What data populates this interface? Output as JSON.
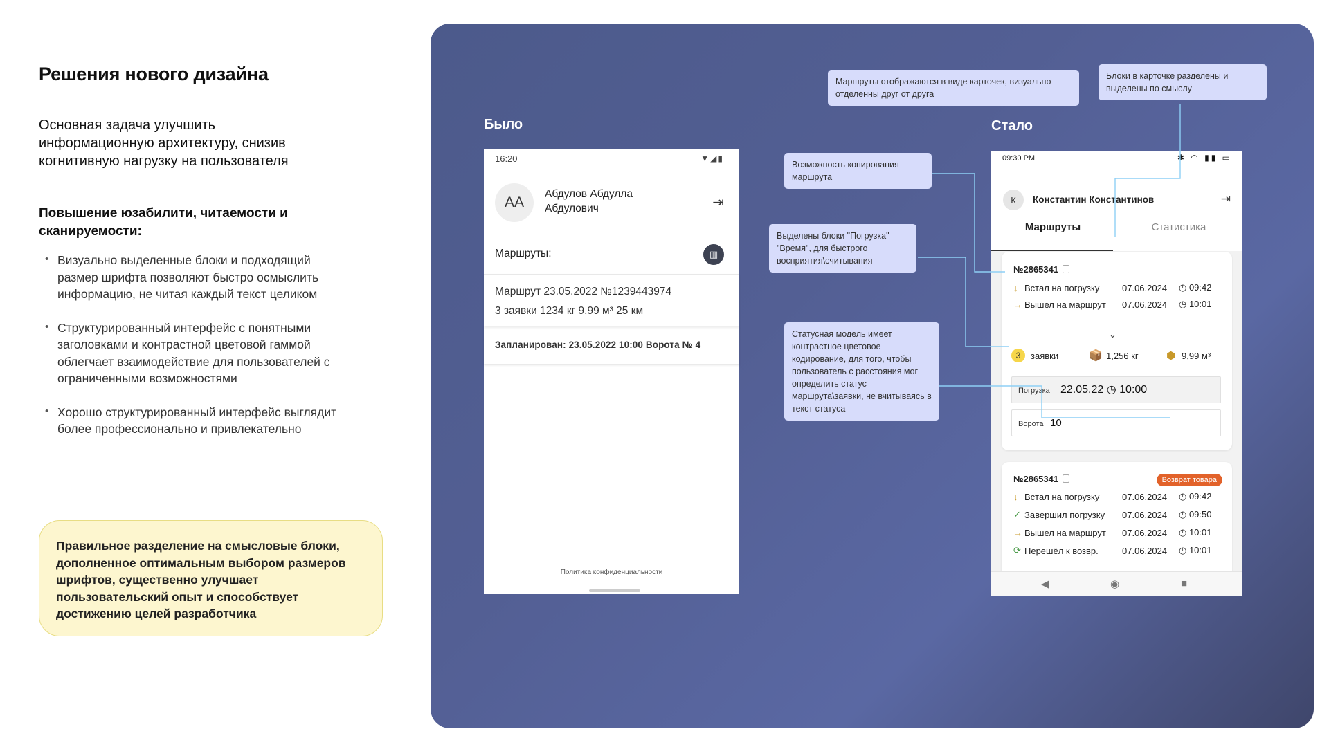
{
  "left": {
    "title": "Решения нового дизайна",
    "task": "Основная задача улучшить информационную архитектуру, снизив когнитивную нагрузку на пользователя",
    "subtitle": "Повышение юзабилити, читаемости и сканируемости:",
    "bullets": [
      "Визуально выделенные блоки и подходящий размер шрифта позволяют быстро осмыслить информацию, не читая каждый текст целиком",
      "Структурированный интерфейс с понятными заголовками и контрастной цветовой гаммой облегчает взаимодействие для пользователей с ограниченными возможностями",
      "Хорошо структурированный интерфейс выглядит более профессионально и привлекательно"
    ],
    "note": "Правильное разделение на смысловые блоки, дополненное  оптимальным выбором размеров шрифтов, существенно улучшает пользовательский опыт и способствует достижению целей разработчика"
  },
  "labels": {
    "before": "Было",
    "after": "Стало"
  },
  "old": {
    "time": "16:20",
    "status_icons": "▼◢▮",
    "avatar": "AA",
    "name": "Абдулов Абдулла Абдулович",
    "routes_label": "Маршруты:",
    "route_line1": "Маршрут 23.05.2022 №1239443974",
    "route_line2": "3 заявки   1234 кг   9,99 м³   25 км",
    "planned": "Запланирован:  23.05.2022   10:00   Ворота № 4",
    "policy": "Политика конфиденциальности"
  },
  "new": {
    "time": "09:30 PM",
    "status_icons": "✱ ◠ ▮▮ ▭",
    "avatar": "К",
    "name": "Константин Константинов",
    "tabs": {
      "routes": "Маршруты",
      "stats": "Статистика"
    },
    "card1": {
      "id": "№2865341",
      "rows": [
        {
          "label": "Встал на погрузку",
          "date": "07.06.2024",
          "time": "◷ 09:42"
        },
        {
          "label": "Вышел на маршрут",
          "date": "07.06.2024",
          "time": "◷ 10:01"
        }
      ],
      "count": "3",
      "count_label": "заявки",
      "weight": "1,256 кг",
      "volume": "9,99 м³",
      "load_label": "Погрузка",
      "load_date": "22.05.22",
      "load_time": "◷ 10:00",
      "gate_label": "Ворота",
      "gate_value": "10"
    },
    "card2": {
      "id": "№2865341",
      "badge": "Возврат товара",
      "rows": [
        {
          "label": "Встал на погрузку",
          "date": "07.06.2024",
          "time": "◷ 09:42"
        },
        {
          "label": "Завершил погрузку",
          "date": "07.06.2024",
          "time": "◷ 09:50"
        },
        {
          "label": "Вышел на маршрут",
          "date": "07.06.2024",
          "time": "◷ 10:01"
        },
        {
          "label": "Перешёл к возвр.",
          "date": "07.06.2024",
          "time": "◷ 10:01"
        }
      ]
    }
  },
  "callouts": {
    "cards": "Маршруты отображаются в виде карточек, визуально отделенны друг от друга",
    "blocks": "Блоки в карточке разделены и выделены по смыслу",
    "copy": "Возможность копирования маршрута",
    "highlight": "Выделены блоки \"Погрузка\" \"Время\", для быстрого восприятия\\считывания",
    "status": "Статусная модель имеет контрастное цветовое кодирование, для того, чтобы пользователь с расстояния мог определить статус маршрута\\заявки, не вчитываясь в текст статуса"
  }
}
